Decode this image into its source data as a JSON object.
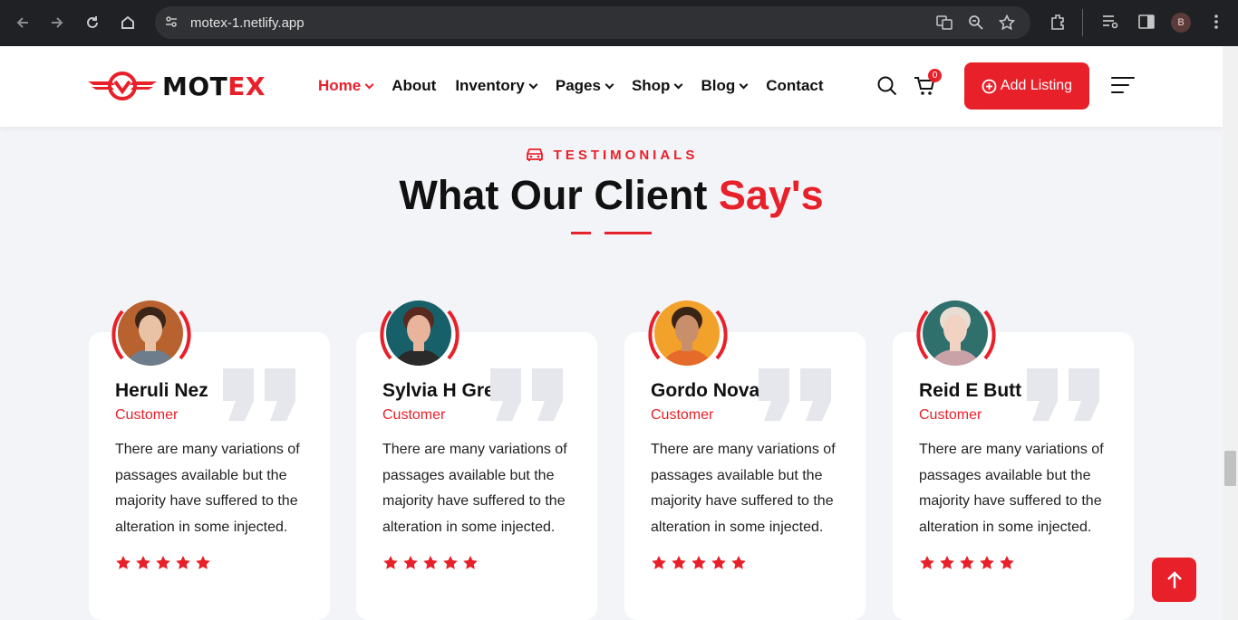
{
  "browser": {
    "url": "motex-1.netlify.app",
    "profile_initial": "B",
    "icons": [
      "back-icon",
      "forward-icon",
      "reload-icon",
      "home-icon",
      "site-info-icon",
      "translate-icon",
      "zoom-icon",
      "star-icon",
      "extensions-icon",
      "media-icon",
      "sidepanel-icon",
      "menu-icon"
    ]
  },
  "site": {
    "logo": {
      "part1": "MOT",
      "part2": "EX"
    },
    "menu": [
      {
        "label": "Home",
        "dropdown": true,
        "active": true
      },
      {
        "label": "About",
        "dropdown": false
      },
      {
        "label": "Inventory",
        "dropdown": true
      },
      {
        "label": "Pages",
        "dropdown": true
      },
      {
        "label": "Shop",
        "dropdown": true
      },
      {
        "label": "Blog",
        "dropdown": true
      },
      {
        "label": "Contact",
        "dropdown": false
      }
    ],
    "cart_count": "0",
    "add_listing": "Add Listing",
    "accent": "#e8202a"
  },
  "section": {
    "tag": "TESTIMONIALS",
    "title_main": "What Our Client ",
    "title_accent": "Say's"
  },
  "testimonials": [
    {
      "name": "Heruli Nez",
      "role": "Customer",
      "text": "There are many variations of passages available but the majority have suffered to the alteration in some injected.",
      "rating": 5
    },
    {
      "name": "Sylvia H Green",
      "role": "Customer",
      "text": "There are many variations of passages available but the majority have suffered to the alteration in some injected.",
      "rating": 5
    },
    {
      "name": "Gordo Novak",
      "role": "Customer",
      "text": "There are many variations of passages available but the majority have suffered to the alteration in some injected.",
      "rating": 5
    },
    {
      "name": "Reid E Butt",
      "role": "Customer",
      "text": "There are many variations of passages available but the majority have suffered to the alteration in some injected.",
      "rating": 5
    }
  ]
}
